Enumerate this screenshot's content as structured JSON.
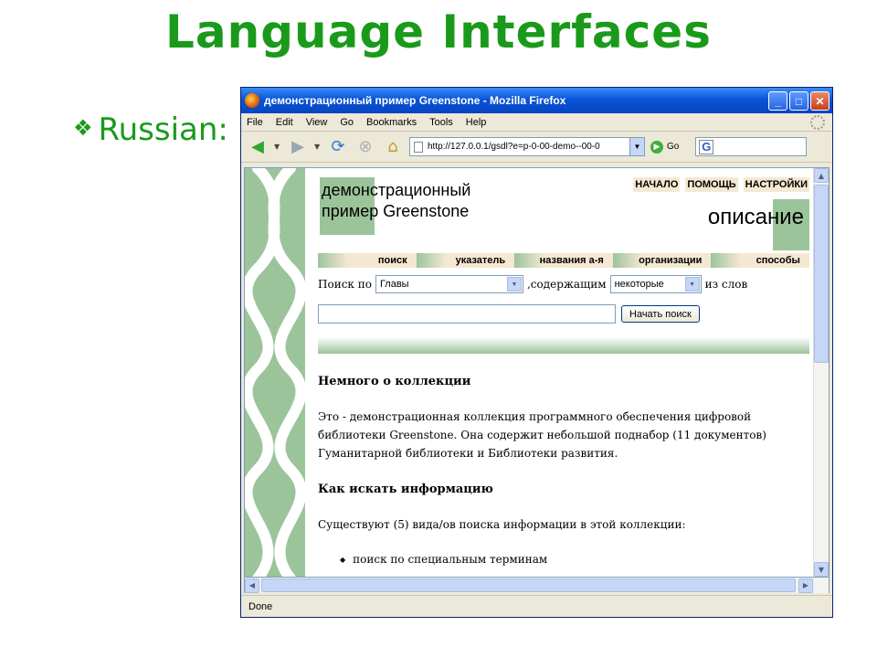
{
  "slide": {
    "title": "Language Interfaces",
    "bullet": "Russian:"
  },
  "window": {
    "title": "демонстрационный пример Greenstone - Mozilla Firefox",
    "menu": [
      "File",
      "Edit",
      "View",
      "Go",
      "Bookmarks",
      "Tools",
      "Help"
    ],
    "url": "http://127.0.0.1/gsdl?e=p-0-00-demo--00-0",
    "go_label": "Go",
    "status": "Done"
  },
  "page": {
    "collection_title": "демонстрационный пример Greenstone",
    "top_nav": [
      "НАЧАЛО",
      "ПОМОЩЬ",
      "НАСТРОЙКИ"
    ],
    "section_title": "описание",
    "tabs": [
      "поиск",
      "указатель",
      "названия а-я",
      "организации",
      "способы"
    ],
    "search": {
      "prefix": "Поиск по",
      "field_value": "Главы",
      "middle": ",содержащим",
      "mode_value": "некоторые",
      "suffix": "из слов",
      "button": "Начать поиск"
    },
    "about_heading": "Немного о коллекции",
    "about_text": "Это - демонстрационная коллекция программного обеспечения цифровой библиотеки Greenstone. Она содержит небольшой поднабор (11 документов) Гуманитарной библиотеки и Библиотеки развития.",
    "howto_heading": "Как искать информацию",
    "howto_text": "Существуют (5) вида/ов поиска информации в этой коллекции:",
    "howto_items": [
      "поиск по специальным терминам"
    ]
  },
  "colors": {
    "title_green": "#1a9a1a",
    "page_green": "#9bc49b",
    "tab_beige": "#f5e8d2",
    "xp_blue": "#0a55d8"
  }
}
